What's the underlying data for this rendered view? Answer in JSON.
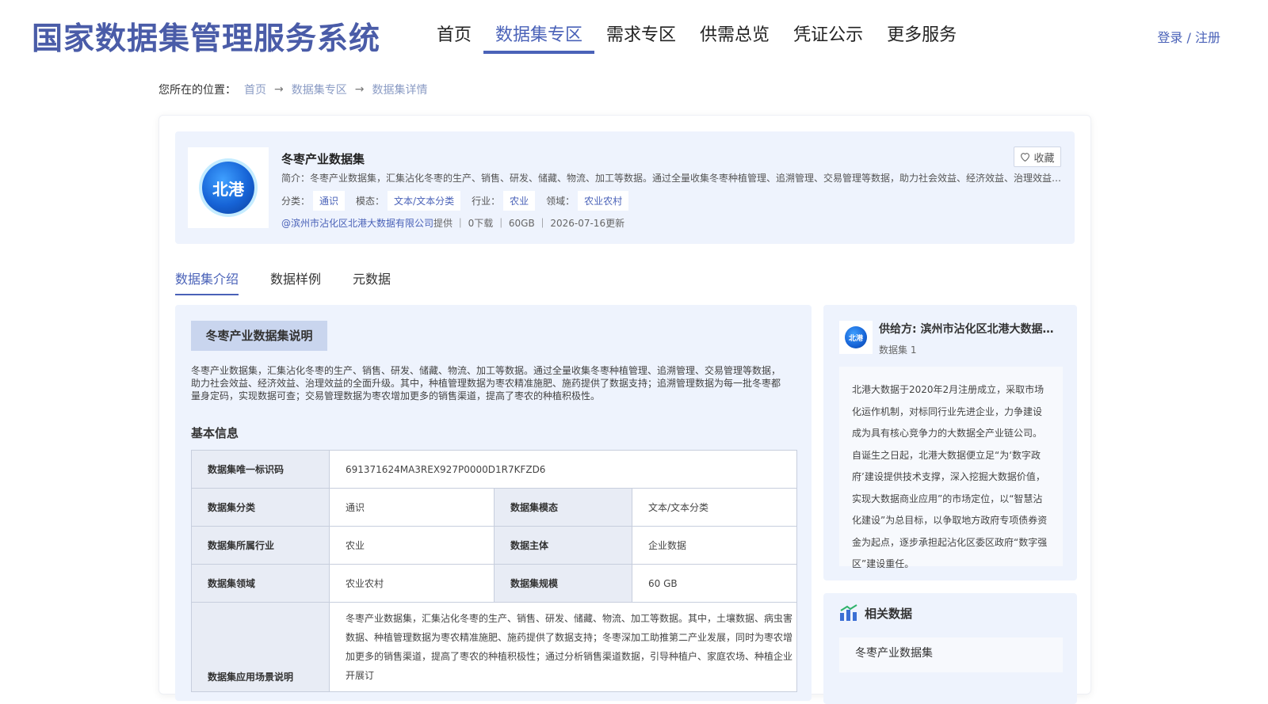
{
  "header": {
    "site_title": "国家数据集管理服务系统",
    "nav": [
      {
        "label": "首页"
      },
      {
        "label": "数据集专区"
      },
      {
        "label": "需求专区"
      },
      {
        "label": "供需总览"
      },
      {
        "label": "凭证公示"
      },
      {
        "label": "更多服务"
      }
    ],
    "login": "登录",
    "separator": " / ",
    "register": "注册"
  },
  "breadcrumb": {
    "prefix": "您所在的位置：",
    "items": [
      "首页",
      "数据集专区",
      "数据集详情"
    ]
  },
  "dataset": {
    "logo_text": "北港",
    "title": "冬枣产业数据集",
    "favorite_label": "收藏",
    "intro": "简介：冬枣产业数据集，汇集沾化冬枣的生产、销售、研发、储藏、物流、加工等数据。通过全量收集冬枣种植管理、追溯管理、交易管理等数据，助力社会效益、经济效益、治理效益的全面升级。",
    "tags": [
      {
        "label": "分类：",
        "value": "通识"
      },
      {
        "label": "模态：",
        "value": "文本/文本分类"
      },
      {
        "label": "行业：",
        "value": "农业"
      },
      {
        "label": "领域：",
        "value": "农业农村"
      }
    ],
    "provider_link": "@滨州市沾化区北港大数据有限公司",
    "meta_rest": "提供 ｜ 0下载 ｜ 60GB ｜ 2026-07-16更新"
  },
  "tabs": [
    "数据集介绍",
    "数据样例",
    "元数据"
  ],
  "intro_section": {
    "title": "冬枣产业数据集说明",
    "description": "冬枣产业数据集，汇集沾化冬枣的生产、销售、研发、储藏、物流、加工等数据。通过全量收集冬枣种植管理、追溯管理、交易管理等数据，助力社会效益、经济效益、治理效益的全面升级。其中，种植管理数据为枣农精准施肥、施药提供了数据支持；追溯管理数据为每一批冬枣都量身定码，实现数据可查；交易管理数据为枣农增加更多的销售渠道，提高了枣农的种植积极性。",
    "basic_info_title": "基本信息",
    "table": {
      "uid_label": "数据集唯一标识码",
      "uid_value": "691371624MA3REX927P0000D1R7KFZD6",
      "category_label": "数据集分类",
      "category_value": "通识",
      "modality_label": "数据集模态",
      "modality_value": "文本/文本分类",
      "industry_label": "数据集所属行业",
      "industry_value": "农业",
      "subject_label": "数据主体",
      "subject_value": "企业数据",
      "domain_label": "数据集领域",
      "domain_value": "农业农村",
      "scale_label": "数据集规模",
      "scale_value": "60 GB",
      "scenario_label": "数据集应用场景说明",
      "scenario_value": "冬枣产业数据集，汇集沾化冬枣的生产、销售、研发、储藏、物流、加工等数据。其中，土壤数据、病虫害数据、种植管理数据为枣农精准施肥、施药提供了数据支持；冬枣深加工助推第二产业发展，同时为枣农增加更多的销售渠道，提高了枣农的种植积极性；通过分析销售渠道数据，引导种植户、家庭农场、种植企业开展订"
    }
  },
  "provider": {
    "logo_text": "北港",
    "name": "供给方: 滨州市沾化区北港大数据有限公司",
    "count_text": "数据集 1",
    "description": "北港大数据于2020年2月注册成立，采取市场化运作机制，对标同行业先进企业，力争建设成为具有核心竞争力的大数据全产业链公司。自诞生之日起，北港大数据便立足“为‘数字政府’建设提供技术支撑，深入挖掘大数据价值，实现大数据商业应用”的市场定位，以“智慧沾化建设”为总目标，以争取地方政府专项债券资金为起点，逐步承担起沾化区委区政府“数字强区”建设重任。"
  },
  "related": {
    "title": "相关数据",
    "items": [
      "冬枣产业数据集"
    ]
  },
  "colors": {
    "accent": "#4a62b8",
    "panel_bg": "#eef3fd",
    "label_bg": "#e8ecf5"
  }
}
